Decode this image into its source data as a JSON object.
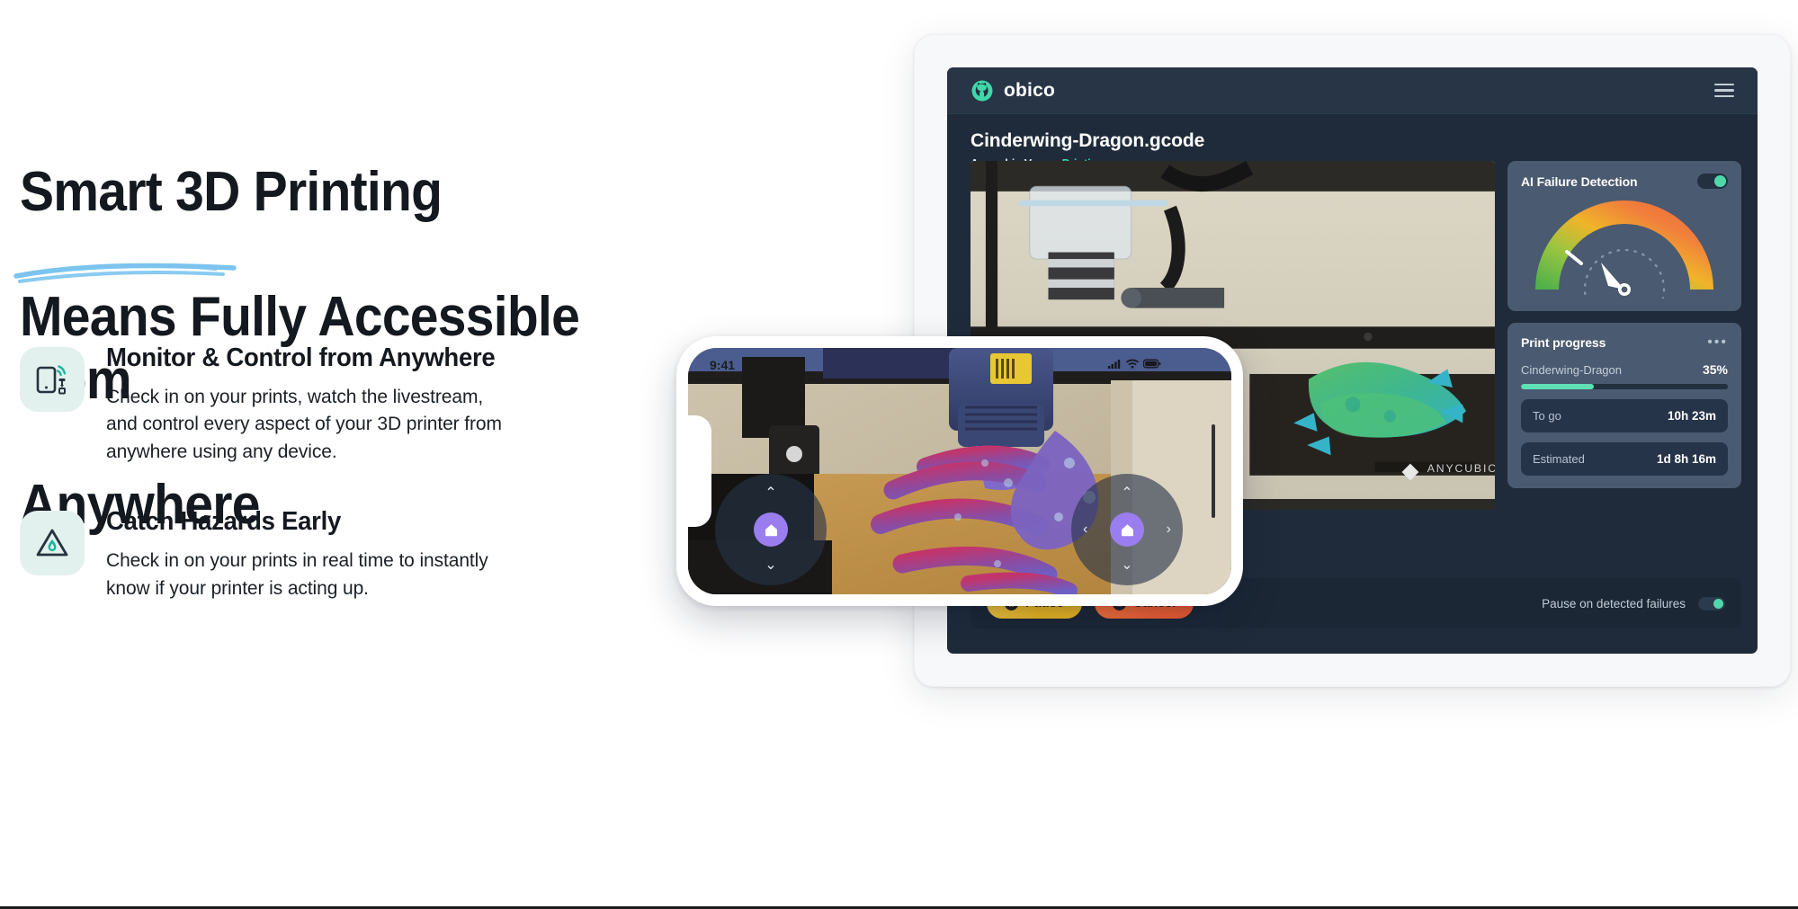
{
  "hero": {
    "headline_lines": [
      "Smart 3D Printing",
      "Means Fully Accessible from",
      "Anywhere"
    ],
    "underline_word": "Anywhere",
    "underline_color": "#7cc4ef"
  },
  "features": [
    {
      "icon": "phone-wifi-printer-icon",
      "title": "Monitor & Control from Anywhere",
      "desc": "Check in on your prints, watch the livestream, and control every aspect of your 3D printer from anywhere using any device."
    },
    {
      "icon": "hazard-flame-triangle-icon",
      "title": "Catch Hazards Early",
      "desc": "Check in on your prints in real time to instantly know if your printer is acting up."
    }
  ],
  "tablet_app": {
    "brand": "obico",
    "menu_icon": "hamburger-menu-icon",
    "job_name": "Cinderwing-Dragon.gcode",
    "printer_label": "Anycubic Vyper:",
    "printer_status": "Printing",
    "status_color": "#41d6a6",
    "ai_panel": {
      "title": "AI Failure Detection",
      "toggle_on": true,
      "gauge": {
        "value_deg": 112,
        "tick_deg": 38,
        "gradient": [
          "#4fb14a",
          "#9bc541",
          "#f0b429",
          "#f0803c",
          "#ef6b3a"
        ]
      }
    },
    "progress_panel": {
      "title": "Print progress",
      "more_icon": "more-horizontal-icon",
      "job": "Cinderwing-Dragon",
      "percent": "35%",
      "percent_value": 35,
      "bar_color": "#5ee0b4",
      "stats": [
        {
          "key": "To go",
          "value": "10h 23m"
        },
        {
          "key": "Estimated",
          "value": "1d 8h 16m"
        }
      ]
    },
    "controls": {
      "pause_label": "Pause",
      "pause_icon": "pause-icon",
      "cancel_label": "Cancel",
      "cancel_icon": "stop-icon",
      "autopause_label": "Pause on detected failures",
      "autopause_on": true
    }
  },
  "phone": {
    "status_time": "9:41",
    "status_icons": [
      "cellular-signal-icon",
      "wifi-icon",
      "battery-icon"
    ],
    "dpad_left": {
      "home_icon": "home-icon",
      "up": "⌃",
      "down": "⌄"
    },
    "dpad_right": {
      "home_icon": "home-icon",
      "up": "⌃",
      "down": "⌄",
      "left": "‹",
      "right": "›"
    }
  }
}
